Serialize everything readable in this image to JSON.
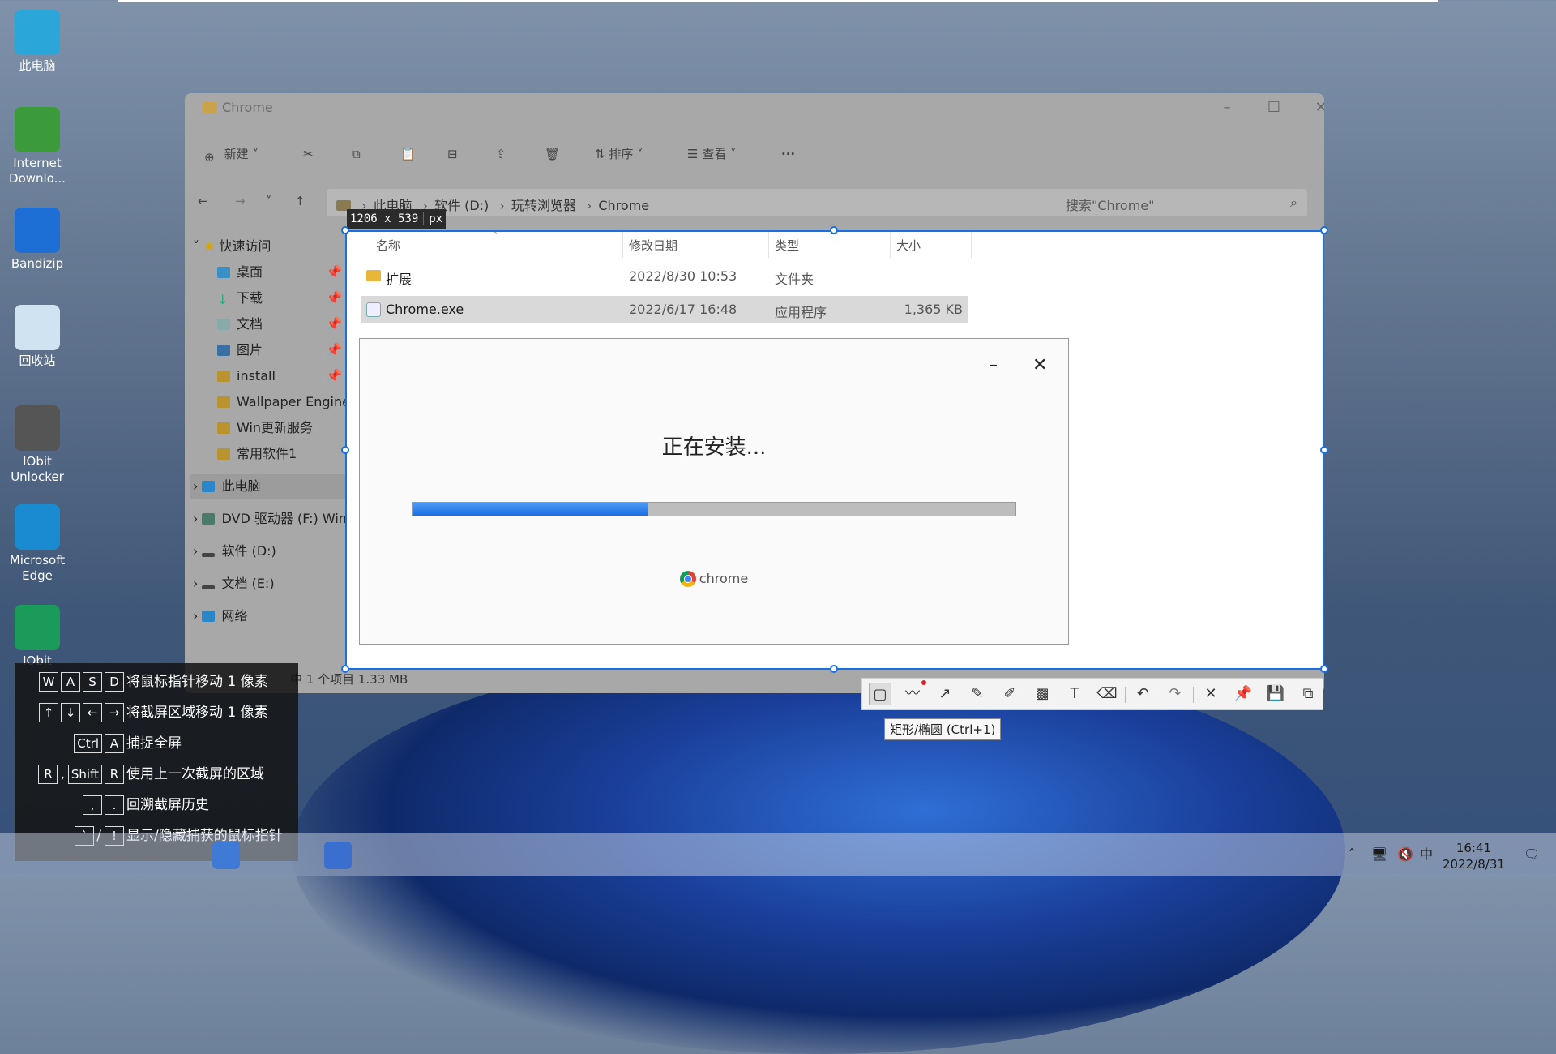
{
  "desktop": {
    "icons": [
      {
        "label": "此电脑",
        "color": "#2aa7d8"
      },
      {
        "label": "Internet Downlo...",
        "color": "#3b9b3b"
      },
      {
        "label": "Bandizip",
        "color": "#1d6fd6"
      },
      {
        "label": "回收站",
        "color": "#cfe3f0"
      },
      {
        "label": "IObit Unlocker",
        "color": "#555555"
      },
      {
        "label": "Microsoft Edge",
        "color": "#1b8bd1"
      },
      {
        "label": "IObit",
        "color": "#1a9b5a"
      }
    ]
  },
  "explorer": {
    "title": "Chrome",
    "toolbar": {
      "new_label": "新建",
      "sort_label": "排序",
      "view_label": "查看",
      "more_label": "···"
    },
    "breadcrumb": [
      "此电脑",
      "软件 (D:)",
      "玩转浏览器",
      "Chrome"
    ],
    "search_placeholder": "搜索\"Chrome\"",
    "nav": {
      "quick_access": "快速访问",
      "items": [
        "桌面",
        "下载",
        "文档",
        "图片",
        "install",
        "Wallpaper Engine",
        "Win更新服务",
        "常用软件1"
      ],
      "this_pc": "此电脑",
      "dvd": "DVD 驱动器 (F:) Win",
      "drive_d": "软件 (D:)",
      "drive_e": "文档 (E:)",
      "network": "网络"
    },
    "columns": [
      "名称",
      "修改日期",
      "类型",
      "大小"
    ],
    "files": [
      {
        "name": "扩展",
        "date": "2022/8/30 10:53",
        "type": "文件夹",
        "size": ""
      },
      {
        "name": "Chrome.exe",
        "date": "2022/6/17 16:48",
        "type": "应用程序",
        "size": "1,365 KB"
      }
    ],
    "status": "中 1 个项目  1.33 MB"
  },
  "selection": {
    "size_label": "1206 x 539",
    "unit": "px"
  },
  "installer": {
    "title": "正在安装...",
    "progress": 0.39,
    "brand": "chrome",
    "minimize": "–",
    "close": "✕"
  },
  "snip_toolbar": {
    "tooltip": "矩形/椭圆 (Ctrl+1)"
  },
  "shortcuts": [
    {
      "keys": [
        "W",
        "A",
        "S",
        "D"
      ],
      "sep": "",
      "desc": "将鼠标指针移动 1 像素"
    },
    {
      "keys": [
        "↑",
        "↓",
        "←",
        "→"
      ],
      "sep": "",
      "desc": "将截屏区域移动 1 像素"
    },
    {
      "keys": [
        "Ctrl",
        "A"
      ],
      "sep": "",
      "desc": "捕捉全屏"
    },
    {
      "keys": [
        "R",
        "Shift",
        "R"
      ],
      "sep": ",",
      "desc": "使用上一次截屏的区域"
    },
    {
      "keys": [
        ",",
        "."
      ],
      "sep": "",
      "desc": "回溯截屏历史"
    },
    {
      "keys": [
        "`",
        "!"
      ],
      "sep": "/",
      "desc": "显示/隐藏捕获的鼠标指针"
    }
  ],
  "taskbar": {
    "time": "16:41",
    "date": "2022/8/31",
    "ime": "中"
  }
}
